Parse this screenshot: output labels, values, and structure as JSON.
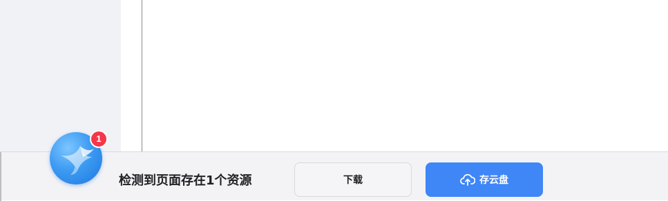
{
  "prompt_bar": {
    "badge_count": "1",
    "message": "检测到页面存在1个资源",
    "download_label": "下载",
    "save_cloud_label": "存云盘"
  },
  "icons": {
    "logo": "bird-logo-icon",
    "cloud": "cloud-upload-icon"
  },
  "colors": {
    "accent_blue": "#3f86f7",
    "badge_red": "#f5374a",
    "sidebar_bg": "#f1f2f6",
    "bar_bg": "#f3f3f6"
  }
}
